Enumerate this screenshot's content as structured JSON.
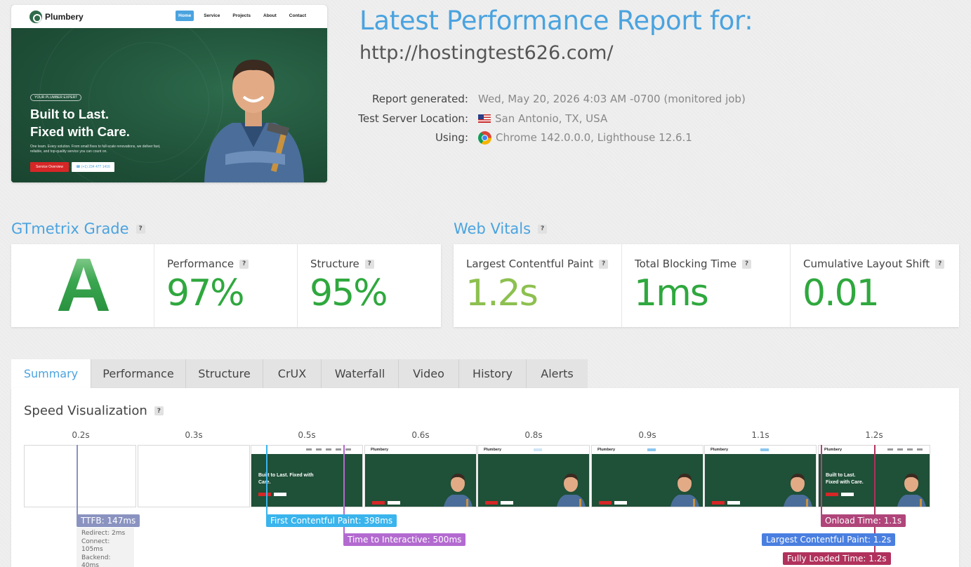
{
  "screenshot": {
    "logo": "Plumbery",
    "menu": [
      "Home",
      "Service",
      "Projects",
      "About",
      "Contact"
    ],
    "tag": "YOUR PLUMBER EXPERT",
    "headline_1": "Built to Last.",
    "headline_2": "Fixed with Care.",
    "subtext": "One team. Every solution. From small fixes to full-scale renovations, we deliver fast, reliable, and top-quality service you can count on.",
    "btn_primary": "Service Overview",
    "btn_secondary": "☎ (+1) 234 477 1416"
  },
  "report": {
    "title": "Latest Performance Report for:",
    "url": "http://hostingtest626.com/",
    "labels": {
      "generated": "Report generated:",
      "location": "Test Server Location:",
      "using": "Using:"
    },
    "generated": "Wed, May 20, 2026 4:03 AM -0700 (monitored job)",
    "location": "San Antonio, TX, USA",
    "using": "Chrome 142.0.0.0, Lighthouse 12.6.1"
  },
  "grade": {
    "heading": "GTmetrix Grade",
    "letter": "A",
    "performance_label": "Performance",
    "performance_value": "97%",
    "structure_label": "Structure",
    "structure_value": "95%"
  },
  "vitals": {
    "heading": "Web Vitals",
    "lcp_label": "Largest Contentful Paint",
    "lcp_value": "1.2s",
    "tbt_label": "Total Blocking Time",
    "tbt_value": "1ms",
    "cls_label": "Cumulative Layout Shift",
    "cls_value": "0.01"
  },
  "tabs": [
    "Summary",
    "Performance",
    "Structure",
    "CrUX",
    "Waterfall",
    "Video",
    "History",
    "Alerts"
  ],
  "speed": {
    "title": "Speed Visualization",
    "times": [
      "0.2s",
      "0.3s",
      "0.5s",
      "0.6s",
      "0.8s",
      "0.9s",
      "1.1s",
      "1.2s"
    ],
    "mini_headline_early": "Built to Last. Fixed with Care.",
    "mini_headline_final": "Built to Last. Fixed with Care.",
    "markers": {
      "ttfb": "TTFB: 147ms",
      "redirect": "Redirect: 2ms",
      "connect": "Connect: 105ms",
      "backend": "Backend: 40ms",
      "fcp": "First Contentful Paint: 398ms",
      "tti": "Time to Interactive: 500ms",
      "onload": "Onload Time: 1.1s",
      "lcp": "Largest Contentful Paint: 1.2s",
      "fully": "Fully Loaded Time: 1.2s"
    }
  },
  "colors": {
    "accent": "#4aa3df",
    "grade_green": "#2fa83e",
    "lcp_green": "#8dc050",
    "ttfb": "#8a93c0",
    "fcp": "#3ab4ec",
    "tti": "#b36ad0",
    "onload": "#b0457a",
    "lcp_marker": "#4a7fe0",
    "fully": "#b0325c"
  }
}
